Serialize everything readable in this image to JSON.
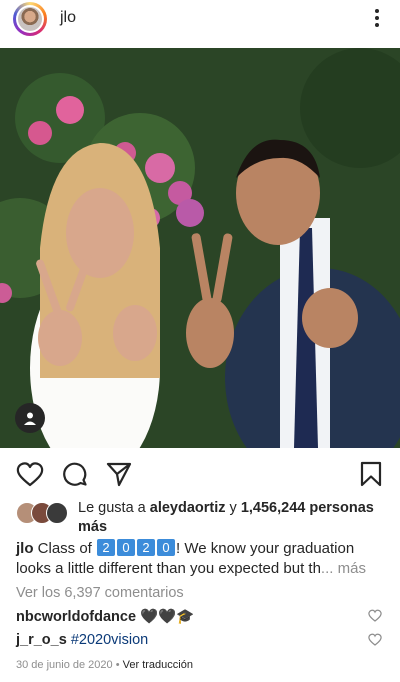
{
  "header": {
    "username": "jlo"
  },
  "post": {
    "likes": {
      "prefix": "Le gusta a ",
      "user": "aleydaortiz",
      "mid": " y ",
      "count": "1,456,244 personas más"
    },
    "caption": {
      "user": "jlo",
      "before": " Class of ",
      "year_digits": [
        "2",
        "0",
        "2",
        "0"
      ],
      "after": "! We know your graduation looks a little different than you expected but th",
      "ellipsis": "...",
      "more": " más"
    },
    "view_comments": "Ver los 6,397 comentarios",
    "comments": [
      {
        "user": "nbcworldofdance",
        "text": " 🖤🖤🎓"
      },
      {
        "user": "j_r_o_s",
        "text": " #2020vision"
      }
    ],
    "date": "30 de junio de 2020",
    "separator": " • ",
    "translate": "Ver traducción"
  }
}
